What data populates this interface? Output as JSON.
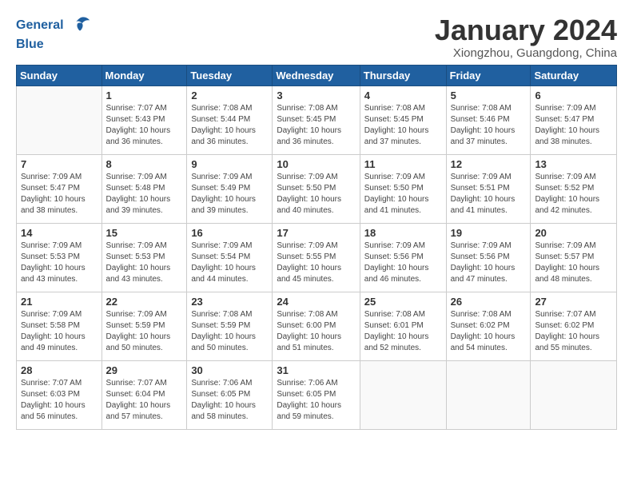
{
  "logo": {
    "general": "General",
    "blue": "Blue"
  },
  "title": "January 2024",
  "subtitle": "Xiongzhou, Guangdong, China",
  "headers": [
    "Sunday",
    "Monday",
    "Tuesday",
    "Wednesday",
    "Thursday",
    "Friday",
    "Saturday"
  ],
  "weeks": [
    [
      {
        "day": "",
        "sunrise": "",
        "sunset": "",
        "daylight": ""
      },
      {
        "day": "1",
        "sunrise": "Sunrise: 7:07 AM",
        "sunset": "Sunset: 5:43 PM",
        "daylight": "Daylight: 10 hours and 36 minutes."
      },
      {
        "day": "2",
        "sunrise": "Sunrise: 7:08 AM",
        "sunset": "Sunset: 5:44 PM",
        "daylight": "Daylight: 10 hours and 36 minutes."
      },
      {
        "day": "3",
        "sunrise": "Sunrise: 7:08 AM",
        "sunset": "Sunset: 5:45 PM",
        "daylight": "Daylight: 10 hours and 36 minutes."
      },
      {
        "day": "4",
        "sunrise": "Sunrise: 7:08 AM",
        "sunset": "Sunset: 5:45 PM",
        "daylight": "Daylight: 10 hours and 37 minutes."
      },
      {
        "day": "5",
        "sunrise": "Sunrise: 7:08 AM",
        "sunset": "Sunset: 5:46 PM",
        "daylight": "Daylight: 10 hours and 37 minutes."
      },
      {
        "day": "6",
        "sunrise": "Sunrise: 7:09 AM",
        "sunset": "Sunset: 5:47 PM",
        "daylight": "Daylight: 10 hours and 38 minutes."
      }
    ],
    [
      {
        "day": "7",
        "sunrise": "Sunrise: 7:09 AM",
        "sunset": "Sunset: 5:47 PM",
        "daylight": "Daylight: 10 hours and 38 minutes."
      },
      {
        "day": "8",
        "sunrise": "Sunrise: 7:09 AM",
        "sunset": "Sunset: 5:48 PM",
        "daylight": "Daylight: 10 hours and 39 minutes."
      },
      {
        "day": "9",
        "sunrise": "Sunrise: 7:09 AM",
        "sunset": "Sunset: 5:49 PM",
        "daylight": "Daylight: 10 hours and 39 minutes."
      },
      {
        "day": "10",
        "sunrise": "Sunrise: 7:09 AM",
        "sunset": "Sunset: 5:50 PM",
        "daylight": "Daylight: 10 hours and 40 minutes."
      },
      {
        "day": "11",
        "sunrise": "Sunrise: 7:09 AM",
        "sunset": "Sunset: 5:50 PM",
        "daylight": "Daylight: 10 hours and 41 minutes."
      },
      {
        "day": "12",
        "sunrise": "Sunrise: 7:09 AM",
        "sunset": "Sunset: 5:51 PM",
        "daylight": "Daylight: 10 hours and 41 minutes."
      },
      {
        "day": "13",
        "sunrise": "Sunrise: 7:09 AM",
        "sunset": "Sunset: 5:52 PM",
        "daylight": "Daylight: 10 hours and 42 minutes."
      }
    ],
    [
      {
        "day": "14",
        "sunrise": "Sunrise: 7:09 AM",
        "sunset": "Sunset: 5:53 PM",
        "daylight": "Daylight: 10 hours and 43 minutes."
      },
      {
        "day": "15",
        "sunrise": "Sunrise: 7:09 AM",
        "sunset": "Sunset: 5:53 PM",
        "daylight": "Daylight: 10 hours and 43 minutes."
      },
      {
        "day": "16",
        "sunrise": "Sunrise: 7:09 AM",
        "sunset": "Sunset: 5:54 PM",
        "daylight": "Daylight: 10 hours and 44 minutes."
      },
      {
        "day": "17",
        "sunrise": "Sunrise: 7:09 AM",
        "sunset": "Sunset: 5:55 PM",
        "daylight": "Daylight: 10 hours and 45 minutes."
      },
      {
        "day": "18",
        "sunrise": "Sunrise: 7:09 AM",
        "sunset": "Sunset: 5:56 PM",
        "daylight": "Daylight: 10 hours and 46 minutes."
      },
      {
        "day": "19",
        "sunrise": "Sunrise: 7:09 AM",
        "sunset": "Sunset: 5:56 PM",
        "daylight": "Daylight: 10 hours and 47 minutes."
      },
      {
        "day": "20",
        "sunrise": "Sunrise: 7:09 AM",
        "sunset": "Sunset: 5:57 PM",
        "daylight": "Daylight: 10 hours and 48 minutes."
      }
    ],
    [
      {
        "day": "21",
        "sunrise": "Sunrise: 7:09 AM",
        "sunset": "Sunset: 5:58 PM",
        "daylight": "Daylight: 10 hours and 49 minutes."
      },
      {
        "day": "22",
        "sunrise": "Sunrise: 7:09 AM",
        "sunset": "Sunset: 5:59 PM",
        "daylight": "Daylight: 10 hours and 50 minutes."
      },
      {
        "day": "23",
        "sunrise": "Sunrise: 7:08 AM",
        "sunset": "Sunset: 5:59 PM",
        "daylight": "Daylight: 10 hours and 50 minutes."
      },
      {
        "day": "24",
        "sunrise": "Sunrise: 7:08 AM",
        "sunset": "Sunset: 6:00 PM",
        "daylight": "Daylight: 10 hours and 51 minutes."
      },
      {
        "day": "25",
        "sunrise": "Sunrise: 7:08 AM",
        "sunset": "Sunset: 6:01 PM",
        "daylight": "Daylight: 10 hours and 52 minutes."
      },
      {
        "day": "26",
        "sunrise": "Sunrise: 7:08 AM",
        "sunset": "Sunset: 6:02 PM",
        "daylight": "Daylight: 10 hours and 54 minutes."
      },
      {
        "day": "27",
        "sunrise": "Sunrise: 7:07 AM",
        "sunset": "Sunset: 6:02 PM",
        "daylight": "Daylight: 10 hours and 55 minutes."
      }
    ],
    [
      {
        "day": "28",
        "sunrise": "Sunrise: 7:07 AM",
        "sunset": "Sunset: 6:03 PM",
        "daylight": "Daylight: 10 hours and 56 minutes."
      },
      {
        "day": "29",
        "sunrise": "Sunrise: 7:07 AM",
        "sunset": "Sunset: 6:04 PM",
        "daylight": "Daylight: 10 hours and 57 minutes."
      },
      {
        "day": "30",
        "sunrise": "Sunrise: 7:06 AM",
        "sunset": "Sunset: 6:05 PM",
        "daylight": "Daylight: 10 hours and 58 minutes."
      },
      {
        "day": "31",
        "sunrise": "Sunrise: 7:06 AM",
        "sunset": "Sunset: 6:05 PM",
        "daylight": "Daylight: 10 hours and 59 minutes."
      },
      {
        "day": "",
        "sunrise": "",
        "sunset": "",
        "daylight": ""
      },
      {
        "day": "",
        "sunrise": "",
        "sunset": "",
        "daylight": ""
      },
      {
        "day": "",
        "sunrise": "",
        "sunset": "",
        "daylight": ""
      }
    ]
  ]
}
